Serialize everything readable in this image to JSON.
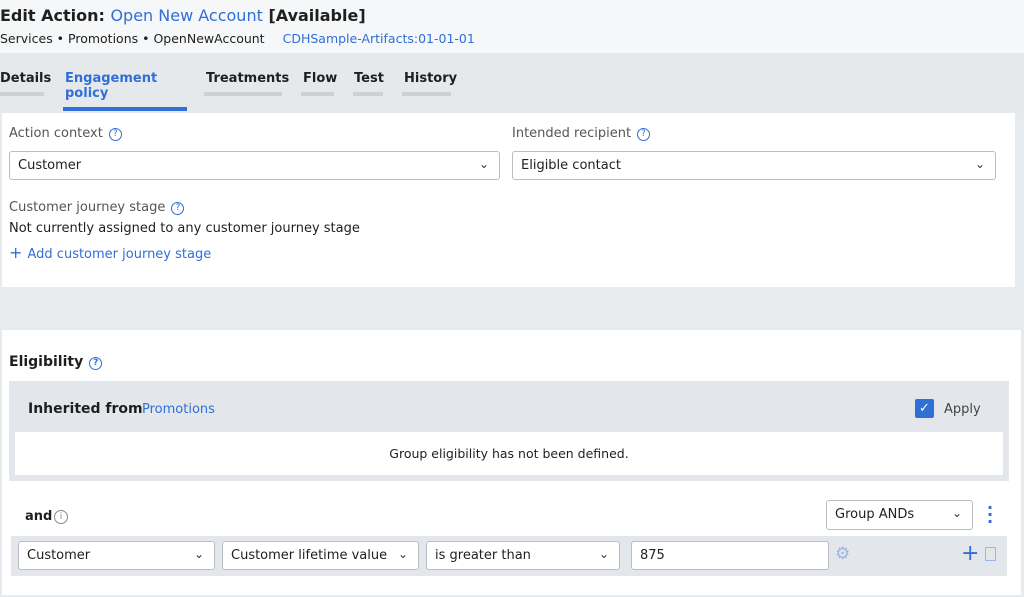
{
  "header": {
    "title_prefix": "Edit Action:",
    "action_name": "Open New Account",
    "status": "[Available]",
    "breadcrumb": "Services • Promotions • OpenNewAccount",
    "ruleset": "CDHSample-Artifacts:01-01-01"
  },
  "tabs": [
    {
      "label": "Details"
    },
    {
      "label": "Engagement policy",
      "active": true
    },
    {
      "label": "Treatments"
    },
    {
      "label": "Flow"
    },
    {
      "label": "Test"
    },
    {
      "label": "History"
    }
  ],
  "context": {
    "action_context_label": "Action context",
    "action_context_value": "Customer",
    "recipient_label": "Intended recipient",
    "recipient_value": "Eligible contact",
    "journey_label": "Customer journey stage",
    "journey_text": "Not currently assigned to any customer journey stage",
    "add_journey": "Add customer journey stage"
  },
  "eligibility": {
    "title": "Eligibility",
    "inherited_label": "Inherited from",
    "inherited_link": "Promotions",
    "apply_label": "Apply",
    "apply_checked": true,
    "group_message": "Group eligibility has not been defined.",
    "and_label": "and",
    "group_mode": "Group ANDs",
    "condition": {
      "entity": "Customer",
      "property": "Customer lifetime value",
      "operator": "is greater than",
      "value": "875"
    }
  },
  "colors": {
    "accent": "#2f6fd6"
  }
}
